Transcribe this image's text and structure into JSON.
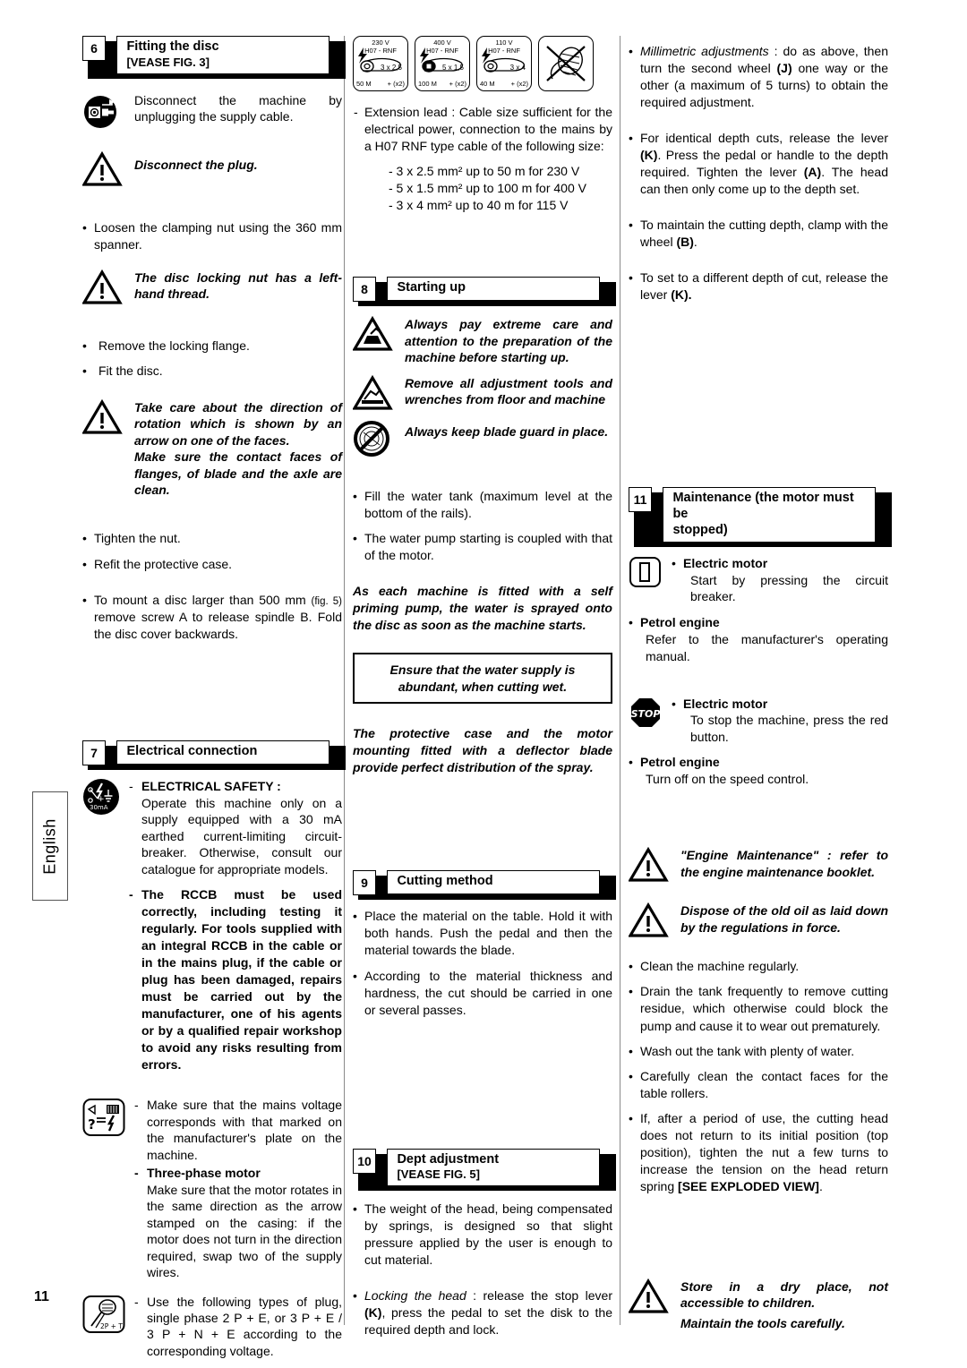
{
  "page": {
    "language_tab": "English",
    "page_number": "11"
  },
  "col1": {
    "sec6": {
      "number": "6",
      "title_line1": "Fitting the disc",
      "title_line2": "[VEASE FIG. 3]"
    },
    "disconnect_note": "Disconnect the machine by unplugging the supply cable.",
    "warn_plug": "Disconnect the plug.",
    "loosen_nut": "Loosen the clamping nut using the 360  mm spanner.",
    "warn_left_thread": "The disc locking nut has a left-hand thread.",
    "remove_flange": "Remove the locking flange.",
    "fit_disc": "Fit the disc.",
    "warn_rotation_1": "Take care about the direction of rotation which is shown by an arrow on one of the faces.",
    "warn_rotation_2": "Make sure the contact faces of flanges, of blade and the axle are clean.",
    "tighten_nut": "Tighten the nut.",
    "refit_case": "Refit the protective case.",
    "mount_large_disc_a": "To mount a disc larger than 500 mm ",
    "mount_large_disc_fig": "(fig. 5)",
    "mount_large_disc_b": " remove screw A to release spindle B. Fold the disc cover backwards.",
    "sec7": {
      "number": "7",
      "title_line1": "Electrical connection",
      "title_line2": ""
    },
    "elec_safety_head": "ELECTRICAL SAFETY :",
    "elec_safety_body": "Operate this machine only on a supply equipped with a 30 mA earthed current-limiting circuit-breaker. Otherwise, consult our catalogue for appropriate models.",
    "rccb_text": "The RCCB must be used correctly, including testing it regularly. For tools supplied with an integral RCCB in the cable or in the mains plug, if the cable or plug has been damaged, repairs must be carried out by the manufacturer, one of his agents or by a qualified repair workshop to avoid any risks resulting from errors.",
    "mains_voltage": "Make sure that the mains voltage corresponds with that marked on the manufacturer's plate on the machine.",
    "three_phase_head": "Three-phase motor",
    "three_phase_body": "Make sure that the motor rotates in the same direction as the arrow stamped on the casing: if the motor does not turn in the direction required, swap two of the supply wires.",
    "plug_types": "Use the following types of plug, single phase 2 P + E, or 3 P + E / 3 P + N + E according to the corresponding voltage."
  },
  "col2": {
    "plates": [
      {
        "voltage": "230 V",
        "type": "H07 - RNF",
        "section": "3 x 2,5",
        "length": "50 M",
        "extra": "+ (x2)",
        "icon": "cable-reel-icon"
      },
      {
        "voltage": "400 V",
        "type": "H07 - RNF",
        "section": "5 x 1,5",
        "length": "100 M",
        "extra": "+ (x2)",
        "icon": "cable-reel-icon"
      },
      {
        "voltage": "110 V",
        "type": "H07 - RNF",
        "section": "3 x 4",
        "length": "40 M",
        "extra": "+ (x2)",
        "icon": "cable-reel-icon"
      },
      {
        "voltage": "",
        "type": "",
        "section": "",
        "length": "",
        "extra": "",
        "icon": "no-coiled-cable-icon"
      }
    ],
    "extension_lead": "Extension lead : Cable size sufficient for the electrical power, connection to the mains by a H07 RNF type cable of the following size:",
    "cable_sizes": [
      "- 3 x 2.5 mm² up to 50 m for 230 V",
      "- 5 x 1.5 mm² up to 100 m for 400 V",
      "- 3 x 4 mm² up to 40 m for 115 V"
    ],
    "sec8": {
      "number": "8",
      "title_line1": "Starting up",
      "title_line2": ""
    },
    "warn_care": "Always pay extreme care and attention to the preparation of the machine before starting up.",
    "warn_tools": "Remove all adjustment tools and wrenches from floor and machine",
    "warn_guard": "Always keep blade guard in place.",
    "fill_tank": "Fill the water tank (maximum level at the bottom of the rails).",
    "pump_coupled": "The water pump starting is coupled with that of the motor.",
    "self_priming": "As each machine is fitted with a self priming pump, the water is sprayed onto the disc as soon as the machine starts.",
    "water_supply_box": "Ensure that the water supply is abundant, when cutting wet.",
    "deflector": "The protective case and the motor mounting fitted with a deflector blade provide perfect distribution of the spray.",
    "sec9": {
      "number": "9",
      "title_line1": "Cutting method",
      "title_line2": ""
    },
    "place_material": "Place the material on the table. Hold it with both hands. Push the pedal and then the material towards the blade.",
    "passes": "According to the material thickness and hardness, the cut should be carried in one or several passes.",
    "sec10": {
      "number": "10",
      "title_line1": "Dept adjustment",
      "title_line2": "[VEASE FIG. 5]"
    },
    "head_weight": "The weight of the head, being compensated by springs, is designed so that slight pressure applied by the user is enough to cut material.",
    "locking_head_em": "Locking the head",
    "locking_head_a": " : release the stop lever ",
    "locking_head_k": "(K)",
    "locking_head_b": ", press the pedal to set the disk to the required depth and lock."
  },
  "col3": {
    "millimetric_em": "Millimetric adjustments",
    "millimetric_a": " : do as above, then turn the second wheel ",
    "millimetric_j": "(J)",
    "millimetric_b": " one way or the other (a maximum of 5 turns) to obtain the required adjustment.",
    "identical_a": "For identical depth cuts, release the lever ",
    "identical_k": "(K)",
    "identical_b": ". Press the pedal or handle to the depth required. Tighten the lever ",
    "identical_aa": "(A)",
    "identical_c": ". The head can then only come up to the depth set.",
    "maintain_a": "To maintain the cutting depth, clamp with the wheel ",
    "maintain_b": "(B)",
    "maintain_c": ".",
    "different_a": "To set to a different depth of cut, release the lever ",
    "different_b": "(K).",
    "sec11": {
      "number": "11",
      "title_line1": "Maintenance (the motor must be",
      "title_line2": "stopped)"
    },
    "electric_motor_start_head": "Electric motor",
    "electric_motor_start_body": "Start by pressing the circuit breaker.",
    "petrol_engine_head_1": "Petrol engine",
    "petrol_engine_body_1": "Refer to the manufacturer's operating manual.",
    "electric_motor_stop_head": "Electric motor",
    "electric_motor_stop_body": "To stop the machine, press the red button.",
    "petrol_engine_head_2": "Petrol engine",
    "petrol_engine_body_2": "Turn off on the speed control.",
    "engine_maintenance": "\"Engine Maintenance\" : refer to the engine maintenance booklet.",
    "dispose_oil": "Dispose of the old oil as laid down by the regulations in force.",
    "clean_machine": "Clean the machine regularly.",
    "drain_tank": "Drain the tank frequently to remove cutting residue, which otherwise could block the pump and cause it to wear out prematurely.",
    "wash_tank": "Wash out the tank with plenty of water.",
    "clean_rollers": "Carefully clean the contact faces for the table rollers.",
    "head_return_a": "If, after a period of use, the cutting head does not return to its initial position (top position), tighten the nut a few turns to increase the tension on the head return spring ",
    "head_return_b": "[SEE EXPLODED VIEW]",
    "head_return_c": ".",
    "store_dry": "Store in a dry place, not accessible to children.",
    "maintain_tools": "Maintain the tools carefully."
  }
}
